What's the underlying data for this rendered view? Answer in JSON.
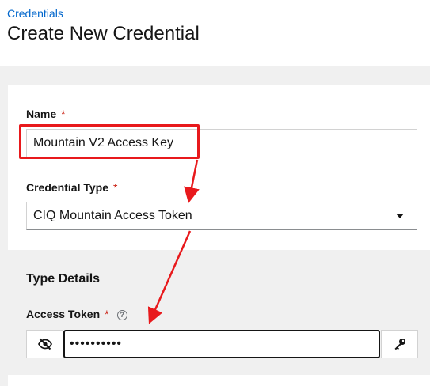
{
  "breadcrumb": {
    "label": "Credentials"
  },
  "page": {
    "title": "Create New Credential"
  },
  "form": {
    "name": {
      "label": "Name",
      "required_mark": "*",
      "value": "Mountain V2 Access Key"
    },
    "credential_type": {
      "label": "Credential Type",
      "required_mark": "*",
      "value": "CIQ Mountain Access Token"
    }
  },
  "type_details": {
    "title": "Type Details",
    "access_token": {
      "label": "Access Token",
      "required_mark": "*",
      "help": "?",
      "value": "••••••••••"
    }
  },
  "annotations": {
    "color": "#e8191c"
  },
  "icons": {
    "visibility": "eye-slash-icon",
    "key": "key-icon",
    "help": "question-circle-icon",
    "caret": "caret-down-icon"
  }
}
